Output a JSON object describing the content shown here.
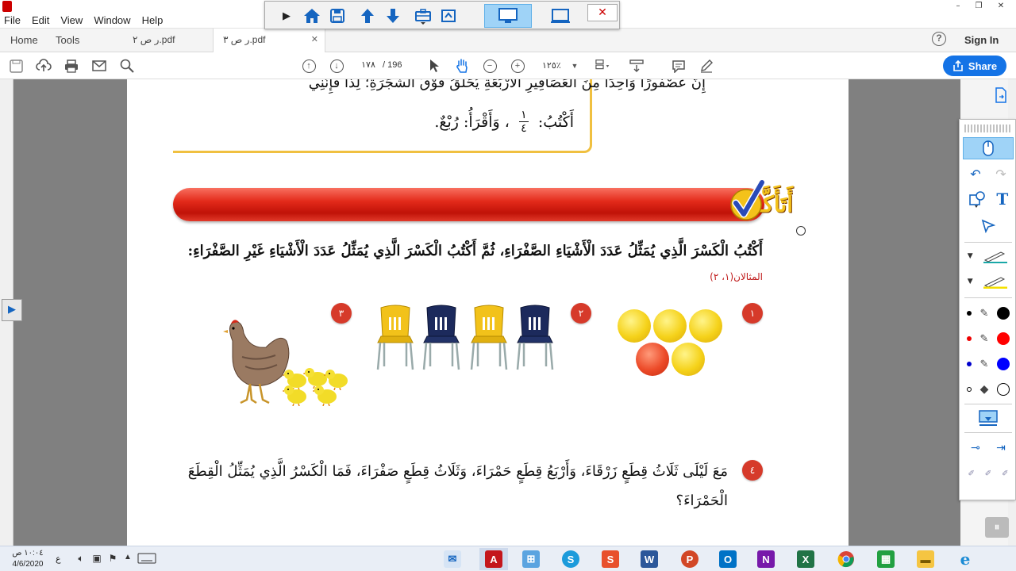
{
  "window": {
    "minimize": "–",
    "maximize": "❐",
    "close": "✕"
  },
  "menu": [
    "File",
    "Edit",
    "View",
    "Window",
    "Help"
  ],
  "floatbar": {
    "close": "✕"
  },
  "tabs": {
    "home": "Home",
    "tools": "Tools",
    "doc1": "ر ص ٢.pdf",
    "doc2": "ر ص ٣.pdf",
    "close": "✕"
  },
  "header": {
    "help": "?",
    "signin": "Sign In"
  },
  "toolbar": {
    "page_current": "١٧٨",
    "page_total": "/ 196",
    "zoom": "١٢٥٪",
    "share": "Share"
  },
  "page": {
    "top_line1": "إِنَّ عُصْفُورًا وَاحِدًا مِنَ الْعَصَافِيرِ الْأَرْبَعَةِ يُحَلِّقُ فَوْقَ الشَّجَرَةِ؛ لِذَا فَإِنَّنِي",
    "top_line2_write": "أَكْتُبُ:",
    "frac_num": "١",
    "frac_den": "٤",
    "top_line2_read": "، وَأَقْرَأُ: رُبْعٌ.",
    "banner_title": "أَتَأَكَّـدُ",
    "instruction": "أَكْتُبُ الْكَسْرَ الَّذِي يُمَثِّلُ عَدَدَ الْأَشْيَاءِ الصَّفْرَاءِ، ثُمَّ أَكْتُبُ الْكَسْرَ الَّذِي يُمَثِّلُ عَدَدَ الْأَشْيَاءِ غَيْرِ الصَّفْرَاءِ:",
    "examples": "المثالان(١، ٢)",
    "badges": [
      "١",
      "٢",
      "٣",
      "٤"
    ],
    "q4_line1": "مَعَ لَيْلَى ثَلَاثُ قِطَعٍ زَرْقَاءَ، وَأَرْبَعُ قِطَعٍ حَمْرَاءَ، وَثَلَاثُ قِطَعٍ صَفْرَاءَ، فَمَا الْكَسْرُ الَّذِي يُمَثِّلُ الْقِطَعَ",
    "q4_line2": "الْحَمْرَاءَ؟"
  },
  "taskbar": {
    "time": "١٠:٠٤ ص",
    "date": "4/6/2020",
    "lang": "ع"
  },
  "colors": {
    "accent": "#1473e6",
    "banner_red": "#e32a1a",
    "banner_text": "#f4c21a",
    "badge_red": "#d63a2a",
    "ball_yellow": "#f5d21a",
    "chair_yellow": "#f2c21a",
    "chair_navy": "#1c2a5c"
  }
}
